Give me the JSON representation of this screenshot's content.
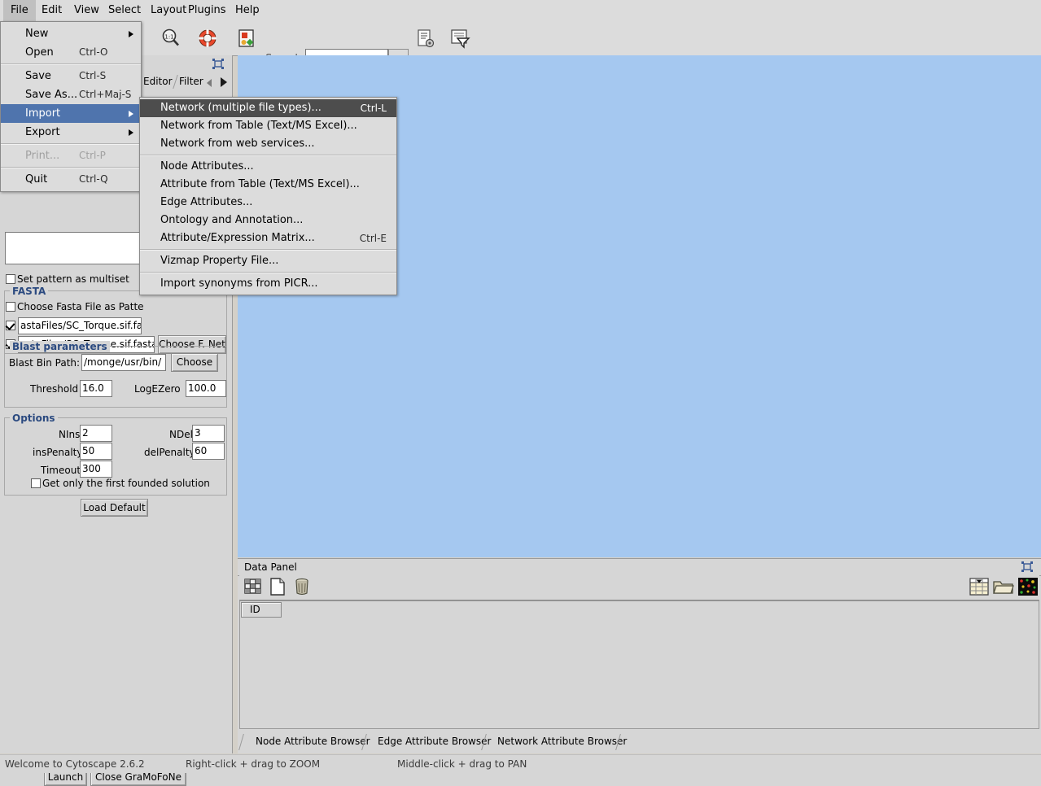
{
  "app": {
    "name": "Cytoscape 2.6.2",
    "canvas_color": "#a5c8f0",
    "accent_blue": "#4f74ad",
    "accent_dark": "#4d4d4d",
    "group_title_color": "#2b4a80"
  },
  "menubar": {
    "items": [
      {
        "label": "File",
        "open": true
      },
      {
        "label": "Edit",
        "open": false
      },
      {
        "label": "View",
        "open": false
      },
      {
        "label": "Select",
        "open": false
      },
      {
        "label": "Layout",
        "open": false
      },
      {
        "label": "Plugins",
        "open": false
      },
      {
        "label": "Help",
        "open": false
      }
    ]
  },
  "toolbar": {
    "search_label": "Search:",
    "search_value": "",
    "search_placeholder": "",
    "icons": [
      "zoom-selected-icon",
      "zoom-actual-size-icon",
      "lifesaver-help-icon",
      "vizmapper-icon",
      "node-attribute-icon",
      "filter-icon"
    ]
  },
  "file_menu": {
    "items": [
      {
        "label": "New",
        "accel": "",
        "submenu": true,
        "state": "normal"
      },
      {
        "label": "Open",
        "accel": "Ctrl-O",
        "submenu": false,
        "state": "normal"
      },
      {
        "sep": true
      },
      {
        "label": "Save",
        "accel": "Ctrl-S",
        "submenu": false,
        "state": "normal"
      },
      {
        "label": "Save As...",
        "accel": "Ctrl+Maj-S",
        "submenu": false,
        "state": "normal"
      },
      {
        "label": "Import",
        "accel": "",
        "submenu": true,
        "state": "selected"
      },
      {
        "label": "Export",
        "accel": "",
        "submenu": true,
        "state": "normal"
      },
      {
        "sep": true
      },
      {
        "label": "Print...",
        "accel": "Ctrl-P",
        "submenu": false,
        "state": "disabled"
      },
      {
        "sep": true
      },
      {
        "label": "Quit",
        "accel": "Ctrl-Q",
        "submenu": false,
        "state": "normal"
      }
    ]
  },
  "import_menu": {
    "items": [
      {
        "label": "Network (multiple file types)...",
        "accel": "Ctrl-L",
        "state": "selected"
      },
      {
        "label": "Network from Table (Text/MS Excel)...",
        "accel": "",
        "state": "normal"
      },
      {
        "label": "Network from web services...",
        "accel": "",
        "state": "normal"
      },
      {
        "sep": true
      },
      {
        "label": "Node Attributes...",
        "accel": "",
        "state": "normal"
      },
      {
        "label": "Attribute from Table (Text/MS Excel)...",
        "accel": "",
        "state": "normal"
      },
      {
        "label": "Edge Attributes...",
        "accel": "",
        "state": "normal"
      },
      {
        "label": "Ontology and Annotation...",
        "accel": "",
        "state": "normal"
      },
      {
        "label": "Attribute/Expression Matrix...",
        "accel": "Ctrl-E",
        "state": "normal"
      },
      {
        "sep": true
      },
      {
        "label": "Vizmap Property File...",
        "accel": "",
        "state": "normal"
      },
      {
        "sep": true
      },
      {
        "label": "Import synonyms from PICR...",
        "accel": "",
        "state": "normal"
      }
    ]
  },
  "control_panel": {
    "tabs": [
      {
        "label": "Editor",
        "selected": false
      },
      {
        "label": "Filter",
        "selected": false
      }
    ],
    "pattern_textarea_value": "",
    "multiset_checkbox": {
      "label": "Set pattern as multiset",
      "checked": false
    },
    "fasta": {
      "title": "FASTA",
      "choose_as_pattern": {
        "label": "Choose Fasta File as Patte",
        "checked": false
      },
      "file_rows": [
        {
          "checked": true,
          "value": "astaFiles/SC_Torque.sif.fa"
        },
        {
          "checked": true,
          "value": "astaFiles/SC_Torque.sif.fasta"
        }
      ],
      "choose_button": "Choose F. Net"
    },
    "blast": {
      "title": "Blast parameters",
      "bin_path_label": "Blast Bin Path:",
      "bin_path_value": "/monge/usr/bin/",
      "choose_button": "Choose",
      "threshold_label": "Threshold",
      "threshold_value": "16.0",
      "logezero_label": "LogEZero",
      "logezero_value": "100.0"
    },
    "options": {
      "title": "Options",
      "fields": [
        {
          "label": "NIns",
          "value": "2"
        },
        {
          "label": "NDel",
          "value": "3"
        },
        {
          "label": "insPenalty",
          "value": "50"
        },
        {
          "label": "delPenalty",
          "value": "60"
        },
        {
          "label": "Timeout",
          "value": "300"
        }
      ],
      "first_solution_checkbox": {
        "label": "Get only the first founded solution",
        "checked": false
      },
      "load_default_button": "Load Default"
    },
    "launch_button": "Launch",
    "close_button": "Close GraMoFoNe"
  },
  "data_panel": {
    "title": "Data Panel",
    "toolbar_icons": [
      "select-attributes-icon",
      "new-attribute-icon",
      "delete-attribute-icon"
    ],
    "right_icons": [
      "export-table-icon",
      "open-folder-icon",
      "heatmap-icon"
    ],
    "columns": [
      "ID"
    ],
    "rows": [],
    "tabs": [
      {
        "label": "Node Attribute Browser",
        "selected": true
      },
      {
        "label": "Edge Attribute Browser",
        "selected": false
      },
      {
        "label": "Network Attribute Browser",
        "selected": false
      }
    ]
  },
  "status_bar": {
    "welcome": "Welcome to Cytoscape 2.6.2",
    "zoom_hint": "Right-click + drag  to  ZOOM",
    "pan_hint": "Middle-click + drag  to  PAN"
  }
}
